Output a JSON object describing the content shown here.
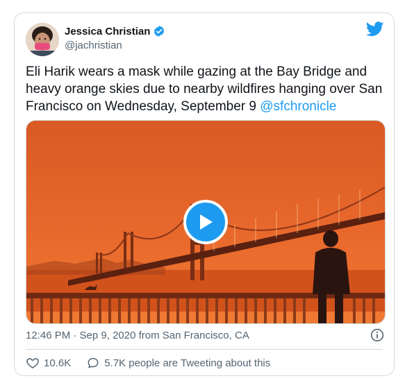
{
  "author": {
    "name": "Jessica Christian",
    "handle": "@jachristian"
  },
  "tweet": {
    "text": "Eli Harik wears a mask while gazing at the Bay Bridge and heavy orange skies due to nearby wildfires hanging over San Francisco on Wednesday, September 9",
    "mention": "@sfchronicle"
  },
  "meta": {
    "timestamp": "12:46 PM · Sep 9, 2020 from San Francisco, CA"
  },
  "actions": {
    "like_count": "10.6K",
    "conversation": "5.7K people are Tweeting about this"
  },
  "colors": {
    "accent": "#1d9bf0",
    "sky": "#e8652a",
    "text_secondary": "#536471"
  },
  "icons": [
    "verified-badge-icon",
    "twitter-bird-icon",
    "play-icon",
    "info-icon",
    "heart-icon",
    "speech-bubble-icon"
  ]
}
